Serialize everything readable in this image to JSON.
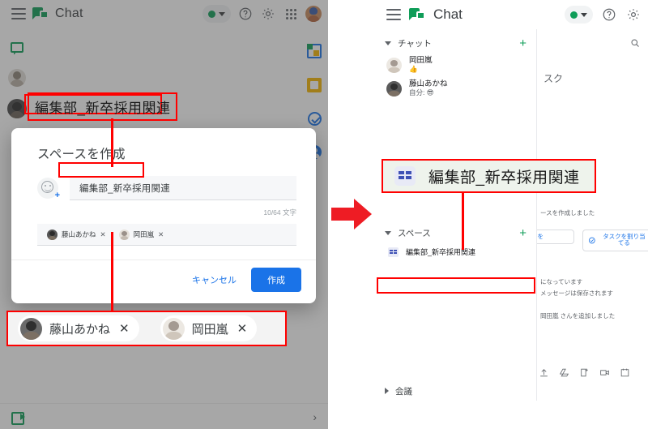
{
  "left_panel": {
    "topbar": {
      "menu_icon": "hamburger-menu-icon",
      "logo_icon": "google-chat-logo",
      "brand": "Chat",
      "status_icon": "status-available-dot",
      "help_icon": "help-icon",
      "settings_icon": "gear-icon",
      "apps_icon": "apps-grid-icon",
      "account_icon": "account-avatar"
    },
    "rail_icons": [
      "chat-bubble-icon",
      "person-avatar-icon",
      "person-avatar-icon"
    ],
    "side_panel_icons": [
      "google-calendar-icon",
      "google-keep-icon",
      "google-tasks-icon",
      "google-contacts-icon"
    ],
    "bottom": {
      "meet_icon": "google-meet-icon",
      "expand_chevron": "›"
    }
  },
  "callout_top_left": {
    "label": "編集部_新卒採用関連"
  },
  "dialog": {
    "title": "スペースを作成",
    "emoji_button": "add-emoji-icon",
    "space_name_value": "編集部_新卒採用関連",
    "char_count": "10/64 文字",
    "members": [
      {
        "name": "藤山あかね",
        "remove": "✕"
      },
      {
        "name": "岡田嵐",
        "remove": "✕"
      }
    ],
    "cancel_label": "キャンセル",
    "create_label": "作成",
    "accent_color": "#1a73e8"
  },
  "callout_bottom_left": {
    "chips": [
      {
        "name": "藤山あかね",
        "remove": "✕"
      },
      {
        "name": "岡田嵐",
        "remove": "✕"
      }
    ]
  },
  "arrow": {
    "direction": "right",
    "color": "#ee1c24"
  },
  "right_panel": {
    "topbar": {
      "menu_icon": "hamburger-menu-icon",
      "logo_icon": "google-chat-logo",
      "brand": "Chat",
      "status_icon": "status-available-dot",
      "help_icon": "help-icon",
      "settings_icon": "gear-icon"
    },
    "sections": [
      {
        "label": "チャット",
        "add_icon": "+",
        "items": [
          {
            "name": "岡田嵐",
            "sub": "👍"
          },
          {
            "name": "藤山あかね",
            "sub": "自分: 😎"
          }
        ]
      },
      {
        "label": "スペース",
        "add_icon": "+",
        "spaces": [
          {
            "name": "編集部_新卒採用関連",
            "icon": "space-grid-icon"
          }
        ]
      },
      {
        "label": "会議",
        "add_icon": ""
      }
    ],
    "content": {
      "search_icon": "search-icon",
      "tab_text": "スク",
      "messages": [
        "ースを作成しました",
        "になっています",
        "メッセージは保存されます",
        "岡田嵐 さんを追加しました"
      ],
      "suggestion_buttons": [
        {
          "label": "ルを",
          "icon": "calendar-icon"
        },
        {
          "label": "タスクを割り当てる",
          "icon": "tasks-icon"
        }
      ],
      "compose_icons": [
        "upload-icon",
        "drive-icon",
        "task-add-icon",
        "video-icon",
        "calendar-icon"
      ]
    }
  },
  "callout_right": {
    "icon": "space-grid-icon",
    "label": "編集部_新卒採用関連"
  }
}
